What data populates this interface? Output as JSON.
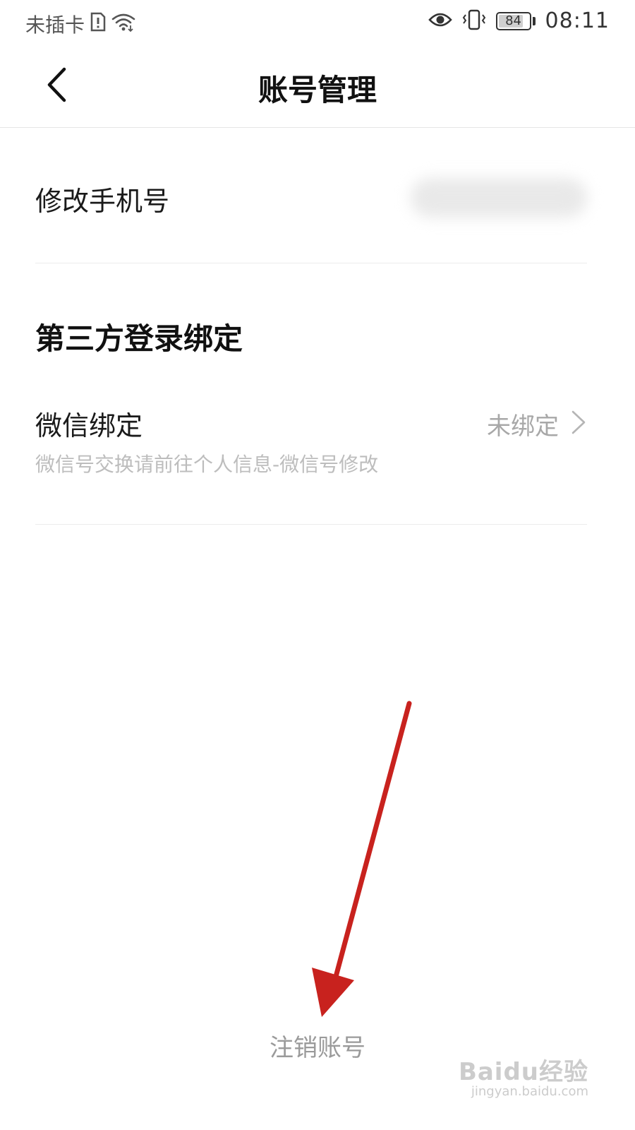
{
  "status_bar": {
    "carrier": "未插卡",
    "battery": "84",
    "battery_level": 0.84,
    "time": "08:11"
  },
  "header": {
    "title": "账号管理"
  },
  "phone_row": {
    "label": "修改手机号"
  },
  "third_party": {
    "section_title": "第三方登录绑定",
    "wechat": {
      "label": "微信绑定",
      "status": "未绑定",
      "hint": "微信号交换请前往个人信息-微信号修改"
    }
  },
  "footer": {
    "deregister_label": "注销账号"
  },
  "annotation": {
    "arrow_color": "#c8221e"
  },
  "watermark": {
    "brand": "Baidu经验",
    "url": "jingyan.baidu.com"
  }
}
